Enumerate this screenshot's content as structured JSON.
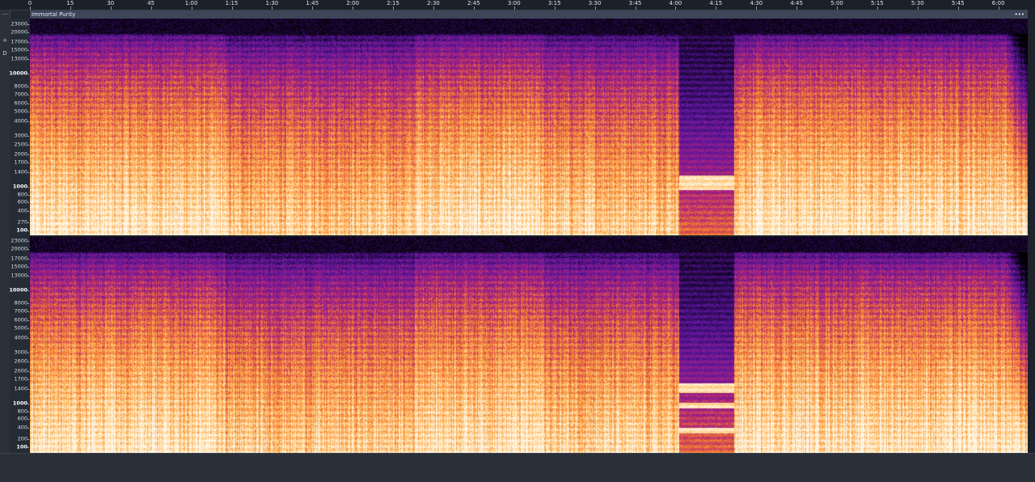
{
  "ruler": {
    "labels": [
      "0",
      "15",
      "30",
      "45",
      "1:00",
      "1:15",
      "1:30",
      "1:45",
      "2:00",
      "2:15",
      "2:30",
      "2:45",
      "3:00",
      "3:15",
      "3:30",
      "3:45",
      "4:00",
      "4:15",
      "4:30",
      "4:45",
      "5:00",
      "5:15",
      "5:30",
      "5:45",
      "6:00",
      "6:1"
    ]
  },
  "left_strip": {
    "top_glyph": "···",
    "plus_glyph": "+",
    "d_glyph": "D"
  },
  "track": {
    "name": "Immortal Purity",
    "menu_glyph": "•••"
  },
  "freq_axis": {
    "channel1": [
      "23000",
      "20000",
      "17000",
      "15000",
      "13000",
      "10000",
      "8000",
      "7000",
      "6000",
      "5000",
      "4000",
      "3000",
      "2500",
      "2000",
      "1700",
      "1400",
      "1000",
      "800",
      "600",
      "400",
      "270",
      "100"
    ],
    "channel1_bold": [
      "10000",
      "1000",
      "100"
    ],
    "channel2": [
      "23000",
      "20000",
      "17000",
      "15000",
      "13000",
      "10000",
      "8000",
      "7000",
      "6000",
      "5000",
      "4000",
      "3000",
      "2600",
      "2000",
      "1700",
      "1400",
      "1000",
      "800",
      "600",
      "400",
      "200",
      "100"
    ],
    "channel2_bold": [
      "10000",
      "1000",
      "100"
    ]
  },
  "spectrogram": {
    "segments_seconds": [
      0,
      71,
      140,
      187,
      236,
      256,
      363
    ],
    "colors": {
      "low": "#1a0533",
      "purple": "#5b16a0",
      "magenta": "#b0237a",
      "orange": "#f57a2c",
      "yellow": "#ffc770",
      "white": "#fff6e8"
    }
  }
}
